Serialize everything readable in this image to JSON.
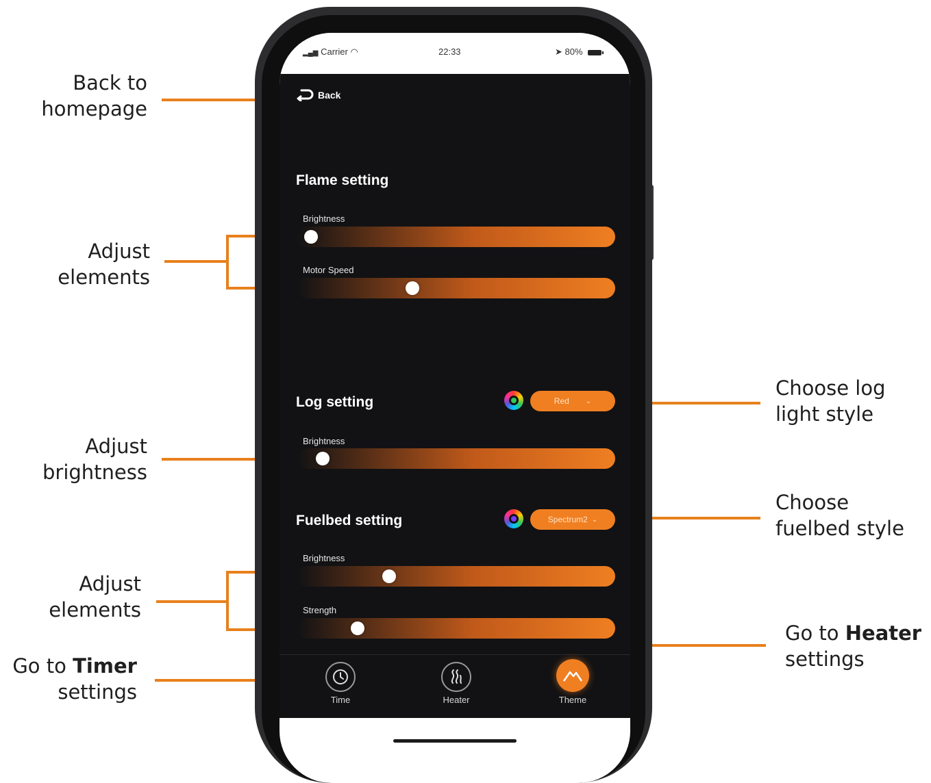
{
  "annotations": {
    "back": [
      "Back to",
      "homepage"
    ],
    "adjust_elements_1": [
      "Adjust",
      "elements"
    ],
    "adjust_brightness": [
      "Adjust",
      "brightness"
    ],
    "adjust_elements_2": [
      "Adjust",
      "elements"
    ],
    "timer": {
      "prefix": "Go to ",
      "bold": "Timer",
      "line2": "settings"
    },
    "log_style": [
      "Choose log",
      "light style"
    ],
    "fuelbed_style": [
      "Choose",
      "fuelbed style"
    ],
    "heater": {
      "prefix": "Go to ",
      "bold": "Heater",
      "line2": "settings"
    }
  },
  "status_bar": {
    "carrier": "Carrier",
    "time": "22:33",
    "battery": "80%"
  },
  "back_label": "Back",
  "flame": {
    "title": "Flame setting",
    "sliders": [
      {
        "label": "Brightness",
        "value": 0.0
      },
      {
        "label": "Motor Speed",
        "value": 0.35
      }
    ]
  },
  "log": {
    "title": "Log setting",
    "style": "Red",
    "style_color": "#34c759",
    "sliders": [
      {
        "label": "Brightness",
        "value": 0.04
      }
    ]
  },
  "fuelbed": {
    "title": "Fuelbed setting",
    "style": "Spectrum2",
    "style_color": "#7a3cff",
    "sliders": [
      {
        "label": "Brightness",
        "value": 0.27
      },
      {
        "label": "Strength",
        "value": 0.16
      }
    ]
  },
  "tabs": [
    {
      "label": "Time",
      "icon": "clock-icon"
    },
    {
      "label": "Heater",
      "icon": "heat-waves-icon"
    },
    {
      "label": "Theme",
      "icon": "mountain-icon",
      "active": true
    }
  ],
  "colors": {
    "accent": "#f07f22",
    "annotation_line": "#e8801c",
    "app_bg": "#121214"
  }
}
